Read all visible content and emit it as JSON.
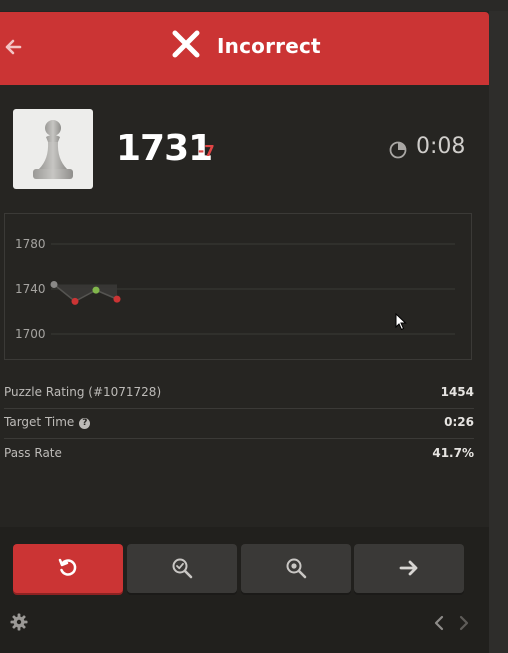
{
  "header": {
    "title": "Incorrect",
    "back_icon": "arrow-left-icon",
    "status_icon": "x-icon"
  },
  "player": {
    "rating": "1731",
    "delta": "-7",
    "timer": "0:08",
    "avatar_icon": "pawn-icon"
  },
  "chart_data": {
    "type": "line",
    "ylim": [
      1680,
      1800
    ],
    "yticks": [
      "1780",
      "1740",
      "1700"
    ],
    "points": [
      {
        "x": 1,
        "y": 1744,
        "result": "neutral"
      },
      {
        "x": 2,
        "y": 1729,
        "result": "incorrect"
      },
      {
        "x": 3,
        "y": 1739,
        "result": "correct"
      },
      {
        "x": 4,
        "y": 1731,
        "result": "incorrect"
      }
    ],
    "colors": {
      "neutral": "#8a8987",
      "incorrect": "#cb3434",
      "correct": "#81b64c"
    }
  },
  "stats": {
    "puzzle_rating_label": "Puzzle Rating (#1071728)",
    "puzzle_rating_value": "1454",
    "target_time_label": "Target Time",
    "target_time_value": "0:26",
    "pass_rate_label": "Pass Rate",
    "pass_rate_value": "41.7%"
  },
  "actions": [
    {
      "name": "retry",
      "icon": "retry-icon"
    },
    {
      "name": "analysis",
      "icon": "magnify-check-icon"
    },
    {
      "name": "solution",
      "icon": "magnify-gear-icon"
    },
    {
      "name": "next",
      "icon": "arrow-right-icon"
    }
  ],
  "colors": {
    "accent": "#cb3434",
    "bg": "#262522"
  }
}
